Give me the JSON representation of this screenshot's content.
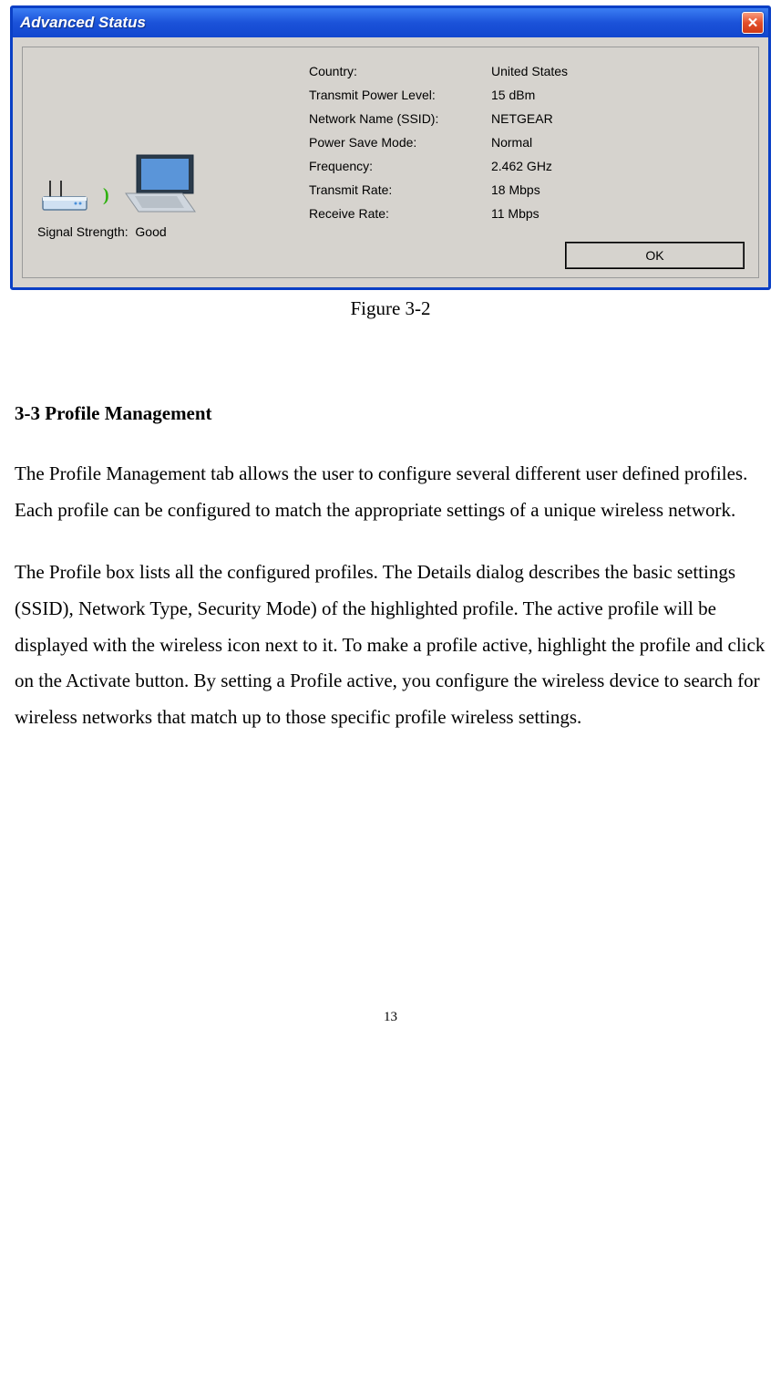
{
  "dialog": {
    "title": "Advanced Status",
    "close_label": "✕",
    "details": [
      {
        "label": "Country:",
        "value": "United States"
      },
      {
        "label": "Transmit Power Level:",
        "value": "15 dBm"
      },
      {
        "label": "Network Name (SSID):",
        "value": "NETGEAR"
      },
      {
        "label": "Power Save Mode:",
        "value": "Normal"
      },
      {
        "label": "Frequency:",
        "value": "2.462 GHz"
      },
      {
        "label": "Transmit Rate:",
        "value": "18 Mbps"
      },
      {
        "label": "Receive Rate:",
        "value": "11 Mbps"
      }
    ],
    "signal_strength_label": "Signal Strength:",
    "signal_strength_value": "Good",
    "ok_label": "OK"
  },
  "figure_caption": "Figure 3-2",
  "section_heading": "3-3 Profile Management",
  "paragraph_1": "The Profile Management tab allows the user to configure several different user defined profiles.  Each profile can be configured to match the appropriate settings of a unique wireless network.",
  "paragraph_2": "The Profile box lists all the configured profiles.  The Details dialog describes the basic settings (SSID), Network Type, Security Mode) of the highlighted profile.  The active profile will be displayed with the wireless icon next to it.  To make a profile active, highlight the profile and click on the Activate button.  By setting a Profile active, you configure the wireless device to search for wireless networks that match up to those specific profile wireless settings.",
  "page_number": "13"
}
